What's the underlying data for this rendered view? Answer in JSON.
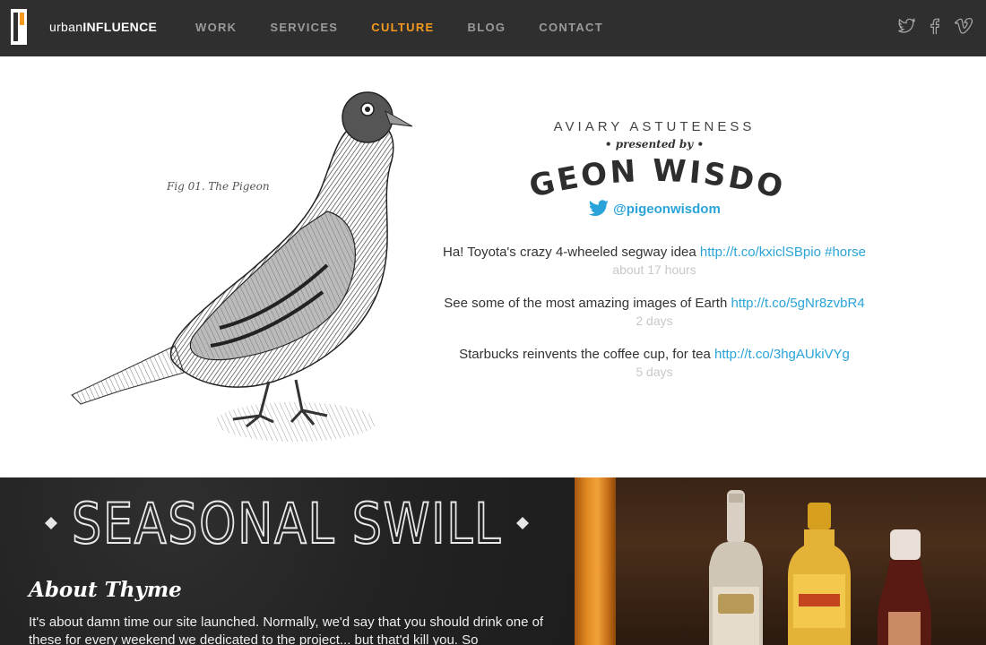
{
  "header": {
    "logo": {
      "light": "urban",
      "bold": "INFLUENCE"
    },
    "nav": [
      {
        "label": "WORK",
        "active": false
      },
      {
        "label": "SERVICES",
        "active": false
      },
      {
        "label": "CULTURE",
        "active": true
      },
      {
        "label": "BLOG",
        "active": false
      },
      {
        "label": "CONTACT",
        "active": false
      }
    ],
    "social_icons": [
      "twitter-icon",
      "facebook-icon",
      "vimeo-icon"
    ]
  },
  "pigeon_section": {
    "figure_caption": {
      "fig": "Fig 01.",
      "name": "The Pigeon"
    },
    "kicker": "AVIARY ASTUTENESS",
    "presented_by": "• presented by •",
    "brand": "PIGEON WISDOM",
    "handle": "@pigeonwisdom",
    "tweets": [
      {
        "text": "Ha! Toyota's crazy 4-wheeled segway idea ",
        "link": "http://t.co/kxiclSBpio",
        "hashtag": " #horse",
        "time": "about 17 hours"
      },
      {
        "text": "See some of the most amazing images of Earth ",
        "link": "http://t.co/5gNr8zvbR4",
        "hashtag": "",
        "time": "2 days"
      },
      {
        "text": "Starbucks reinvents the coffee cup, for tea ",
        "link": "http://t.co/3hgAUkiVYg",
        "hashtag": "",
        "time": "5 days"
      }
    ]
  },
  "swill_section": {
    "title": "SEASONAL SWILL",
    "subtitle": "About Thyme",
    "body": "It's about damn time our site launched. Normally, we'd say that you should drink one of these for every weekend we dedicated to the project... but that'd kill you. So"
  },
  "colors": {
    "header_bg": "#2f2f2f",
    "nav_active": "#f39a1f",
    "link": "#2aa4d8"
  }
}
